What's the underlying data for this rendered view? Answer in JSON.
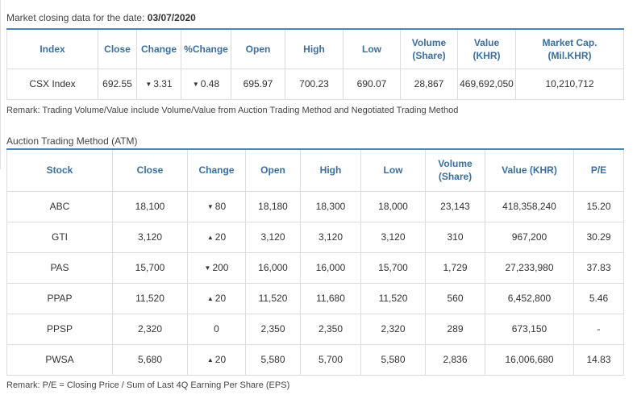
{
  "market": {
    "title_prefix": "Market closing data for the date:",
    "date": "03/07/2020",
    "headers": [
      "Index",
      "Close",
      "Change",
      "%Change",
      "Open",
      "High",
      "Low",
      "Volume (Share)",
      "Value (KHR)",
      "Market Cap. (Mil.KHR)"
    ],
    "header_lines": {
      "volume": [
        "Volume",
        "(Share)"
      ],
      "cap": [
        "Market Cap.",
        "(Mil.KHR)"
      ]
    },
    "row": {
      "index": "CSX Index",
      "close": "692.55",
      "change": "3.31",
      "change_dir": "down",
      "pct_change": "0.48",
      "pct_dir": "down",
      "open": "695.97",
      "high": "700.23",
      "low": "690.07",
      "volume": "28,867",
      "value": "469,692,050",
      "market_cap": "10,210,712"
    },
    "remark": "Remark: Trading Volume/Value include Volume/Value from Auction Trading Method and Negotiated Trading Method"
  },
  "atm": {
    "title": "Auction Trading Method (ATM)",
    "headers": {
      "stock": "Stock",
      "close": "Close",
      "change": "Change",
      "open": "Open",
      "high": "High",
      "low": "Low",
      "volume_1": "Volume",
      "volume_2": "(Share)",
      "value": "Value (KHR)",
      "pe": "P/E"
    },
    "rows": [
      {
        "stock": "ABC",
        "close": "18,100",
        "change": "80",
        "dir": "down",
        "open": "18,180",
        "high": "18,300",
        "low": "18,000",
        "volume": "23,143",
        "value": "418,358,240",
        "pe": "15.20"
      },
      {
        "stock": "GTI",
        "close": "3,120",
        "change": "20",
        "dir": "up",
        "open": "3,120",
        "high": "3,120",
        "low": "3,120",
        "volume": "310",
        "value": "967,200",
        "pe": "30.29"
      },
      {
        "stock": "PAS",
        "close": "15,700",
        "change": "200",
        "dir": "down",
        "open": "16,000",
        "high": "16,000",
        "low": "15,700",
        "volume": "1,729",
        "value": "27,233,980",
        "pe": "37.83"
      },
      {
        "stock": "PPAP",
        "close": "11,520",
        "change": "20",
        "dir": "up",
        "open": "11,520",
        "high": "11,680",
        "low": "11,520",
        "volume": "560",
        "value": "6,452,800",
        "pe": "5.46"
      },
      {
        "stock": "PPSP",
        "close": "2,320",
        "change": "0",
        "dir": "none",
        "open": "2,350",
        "high": "2,350",
        "low": "2,320",
        "volume": "289",
        "value": "673,150",
        "pe": "-"
      },
      {
        "stock": "PWSA",
        "close": "5,680",
        "change": "20",
        "dir": "up",
        "open": "5,580",
        "high": "5,700",
        "low": "5,580",
        "volume": "2,836",
        "value": "16,006,680",
        "pe": "14.83"
      }
    ],
    "remark": "Remark: P/E = Closing Price / Sum of Last 4Q Earning Per Share (EPS)"
  },
  "colors": {
    "header_text": "#3a6fa3",
    "table_top_border": "#4a86b8",
    "down": "#d9261c",
    "up": "#3a9a3a"
  },
  "icons": {
    "down": "caret-down-icon",
    "up": "caret-up-icon"
  }
}
